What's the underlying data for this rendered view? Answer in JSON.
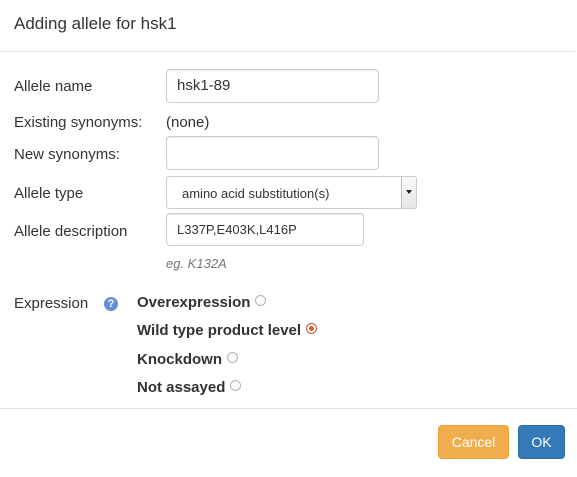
{
  "dialog": {
    "title": "Adding allele for hsk1"
  },
  "form": {
    "allele_name": {
      "label": "Allele name",
      "value": "hsk1-89"
    },
    "existing_synonyms": {
      "label": "Existing synonyms:",
      "value": "(none)"
    },
    "new_synonyms": {
      "label": "New synonyms:",
      "value": ""
    },
    "allele_type": {
      "label": "Allele type",
      "selected": "amino acid substitution(s)"
    },
    "allele_description": {
      "label": "Allele description",
      "value": "L337P,E403K,L416P",
      "hint": "eg. K132A"
    },
    "expression": {
      "label": "Expression",
      "help_icon": "?",
      "options": [
        {
          "label": "Overexpression",
          "checked": false
        },
        {
          "label": "Wild type product level",
          "checked": true
        },
        {
          "label": "Knockdown",
          "checked": false
        },
        {
          "label": "Not assayed",
          "checked": false
        }
      ]
    }
  },
  "footer": {
    "cancel_label": "Cancel",
    "ok_label": "OK"
  },
  "colors": {
    "cancel": "#f0ad4e",
    "ok": "#337ab7",
    "radio_checked": "#d2642f",
    "help_icon": "#6b8fd4"
  }
}
